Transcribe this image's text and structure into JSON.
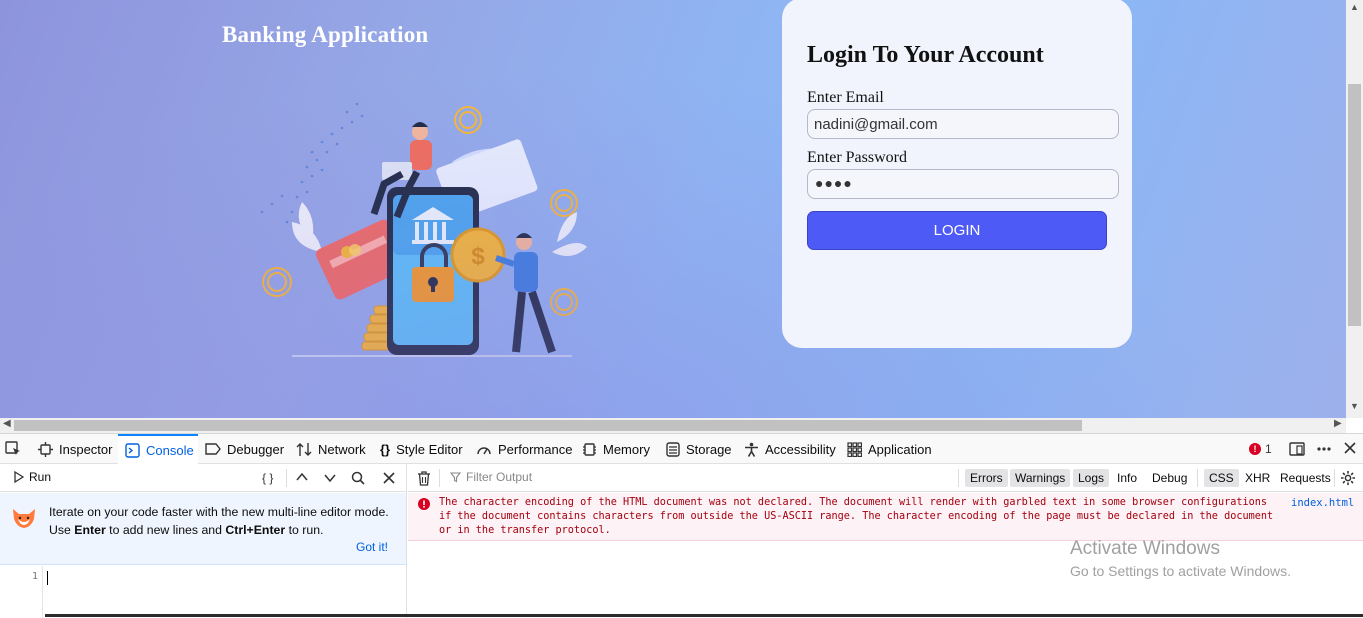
{
  "page": {
    "app_title": "Banking Application",
    "login": {
      "heading": "Login To Your Account",
      "email_label": "Enter Email",
      "email_value": "nadini@gmail.com",
      "password_label": "Enter Password",
      "password_masked": "●●●●",
      "button_label": "LOGIN"
    }
  },
  "devtools": {
    "tabs": [
      {
        "label": "Inspector",
        "icon": "inspector-icon"
      },
      {
        "label": "Console",
        "icon": "console-icon",
        "active": true
      },
      {
        "label": "Debugger",
        "icon": "debugger-icon"
      },
      {
        "label": "Network",
        "icon": "network-icon"
      },
      {
        "label": "Style Editor",
        "icon": "style-editor-icon"
      },
      {
        "label": "Performance",
        "icon": "performance-icon"
      },
      {
        "label": "Memory",
        "icon": "memory-icon"
      },
      {
        "label": "Storage",
        "icon": "storage-icon"
      },
      {
        "label": "Accessibility",
        "icon": "accessibility-icon"
      },
      {
        "label": "Application",
        "icon": "application-icon"
      }
    ],
    "error_count": "1",
    "editor": {
      "run_label": "Run",
      "pretty_print": "{ }",
      "onboarding_line1": "Iterate on your code faster with the new multi-line editor mode.",
      "onboarding_use": "Use ",
      "onboarding_enter": "Enter",
      "onboarding_mid": " to add new lines and ",
      "onboarding_ctrl_enter": "Ctrl+Enter",
      "onboarding_end": " to run.",
      "got_it": "Got it!",
      "line_number": "1"
    },
    "console": {
      "filter_placeholder": "Filter Output",
      "filters": [
        "Errors",
        "Warnings",
        "Logs",
        "Info",
        "Debug",
        "CSS",
        "XHR",
        "Requests"
      ],
      "message": "The character encoding of the HTML document was not declared. The document will render with garbled text in some browser configurations if the document contains characters from outside the US-ASCII range. The character encoding of the page must be declared in the document or in the transfer protocol.",
      "message_source": "index.html"
    }
  },
  "watermark": {
    "line1": "Activate Windows",
    "line2": "Go to Settings to activate Windows."
  },
  "colors": {
    "login_button": "#4e5af5",
    "devtools_active_tab": "#0060df",
    "error_text": "#a4000f"
  }
}
